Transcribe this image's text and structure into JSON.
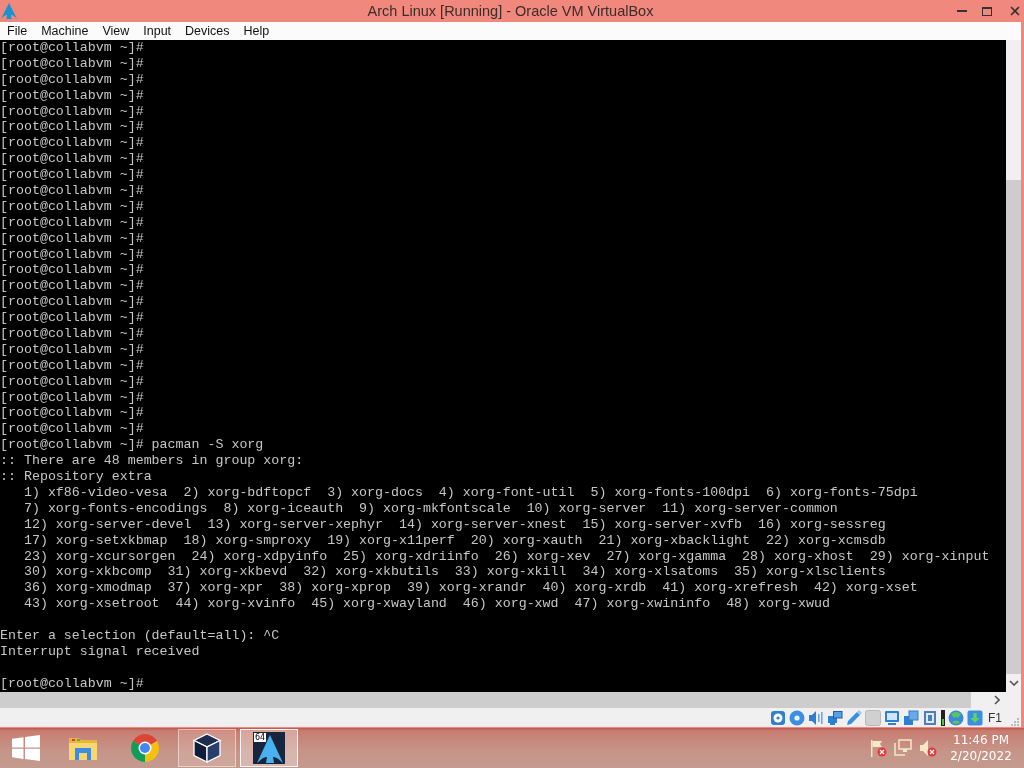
{
  "window": {
    "title": "Arch Linux [Running] - Oracle VM VirtualBox"
  },
  "menu": [
    "File",
    "Machine",
    "View",
    "Input",
    "Devices",
    "Help"
  ],
  "terminal": {
    "blocks": [
      [
        "[root@collabvm ~]#",
        "[root@collabvm ~]#",
        "[root@collabvm ~]#",
        "[root@collabvm ~]#",
        "[root@collabvm ~]#",
        "[root@collabvm ~]#",
        "[root@collabvm ~]#",
        "[root@collabvm ~]#",
        "[root@collabvm ~]#",
        "[root@collabvm ~]#",
        "[root@collabvm ~]#",
        "[root@collabvm ~]#",
        "[root@collabvm ~]#",
        "[root@collabvm ~]#",
        "[root@collabvm ~]#",
        "[root@collabvm ~]#",
        "[root@collabvm ~]#",
        "[root@collabvm ~]#",
        "[root@collabvm ~]#",
        "[root@collabvm ~]#",
        "[root@collabvm ~]#",
        "[root@collabvm ~]#",
        "[root@collabvm ~]#",
        "[root@collabvm ~]#",
        "[root@collabvm ~]#",
        "[root@collabvm ~]# pacman -S xorg",
        ":: There are 48 members in group xorg:",
        ":: Repository extra",
        "   1) xf86-video-vesa  2) xorg-bdftopcf  3) xorg-docs  4) xorg-font-util  5) xorg-fonts-100dpi  6) xorg-fonts-75dpi",
        "   7) xorg-fonts-encodings  8) xorg-iceauth  9) xorg-mkfontscale  10) xorg-server  11) xorg-server-common",
        "   12) xorg-server-devel  13) xorg-server-xephyr  14) xorg-server-xnest  15) xorg-server-xvfb  16) xorg-sessreg",
        "   17) xorg-setxkbmap  18) xorg-smproxy  19) xorg-x11perf  20) xorg-xauth  21) xorg-xbacklight  22) xorg-xcmsdb",
        "   23) xorg-xcursorgen  24) xorg-xdpyinfo  25) xorg-xdriinfo  26) xorg-xev  27) xorg-xgamma  28) xorg-xhost  29) xorg-xinput",
        "   30) xorg-xkbcomp  31) xorg-xkbevd  32) xorg-xkbutils  33) xorg-xkill  34) xorg-xlsatoms  35) xorg-xlsclients",
        "   36) xorg-xmodmap  37) xorg-xpr  38) xorg-xprop  39) xorg-xrandr  40) xorg-xrdb  41) xorg-xrefresh  42) xorg-xset",
        "   43) xorg-xsetroot  44) xorg-xvinfo  45) xorg-xwayland  46) xorg-xwd  47) xorg-xwininfo  48) xorg-xwud"
      ],
      [
        "Enter a selection (default=all): ^C",
        "Interrupt signal received"
      ],
      [
        "[root@collabvm ~]#"
      ]
    ]
  },
  "status_bar": {
    "devices": [
      {
        "kind": "disk",
        "disabled": false
      },
      {
        "kind": "disc",
        "disabled": false
      },
      {
        "kind": "audio",
        "disabled": false
      },
      {
        "kind": "network",
        "disabled": false
      },
      {
        "kind": "usb",
        "disabled": false
      },
      {
        "kind": "shared",
        "disabled": true
      },
      {
        "kind": "display",
        "disabled": false
      },
      {
        "kind": "capture",
        "disabled": false
      },
      {
        "kind": "chip",
        "disabled": false
      },
      {
        "kind": "meter",
        "disabled": false
      },
      {
        "kind": "globe",
        "disabled": false
      },
      {
        "kind": "arrow",
        "disabled": false
      }
    ],
    "host_key": "F1"
  },
  "taskbar": {
    "items": [
      {
        "kind": "folder",
        "running": false,
        "selected": false
      },
      {
        "kind": "tricolor",
        "running": false,
        "selected": false
      },
      {
        "kind": "cube",
        "running": true,
        "selected": false
      },
      {
        "kind": "peak",
        "running": true,
        "selected": true,
        "badge": "64"
      }
    ]
  },
  "tray": {
    "icons": [
      {
        "kind": "flag",
        "alert": true
      },
      {
        "kind": "network",
        "alert": false
      },
      {
        "kind": "speaker",
        "alert": true
      }
    ],
    "time": "11:46 PM",
    "date": "2/20/2022"
  }
}
